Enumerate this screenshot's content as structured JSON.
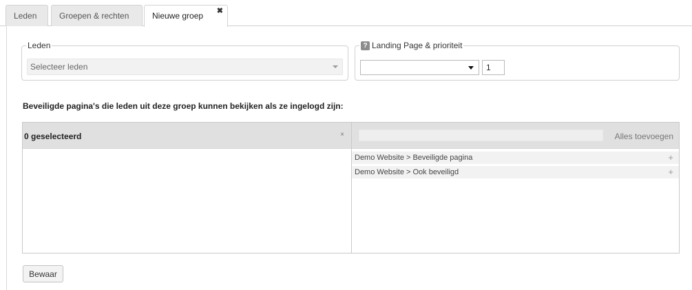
{
  "tabs": [
    {
      "label": "Leden"
    },
    {
      "label": "Groepen & rechten"
    },
    {
      "label": "Nieuwe groep",
      "close": "✖"
    }
  ],
  "leden": {
    "legend": "Leden",
    "placeholder": "Selecteer leden"
  },
  "landing": {
    "help": "?",
    "legend": "Landing Page & prioriteit",
    "page_value": "",
    "priority": "1"
  },
  "secure": {
    "title": "Beveiligde pagina's die leden uit deze groep kunnen bekijken als ze ingelogd zijn:",
    "selected_count": "0 geselecteerd",
    "clear": "×",
    "search_value": "",
    "add_all": "Alles toevoegen",
    "available": [
      {
        "label": "Demo Website > Beveiligde pagina",
        "add": "+"
      },
      {
        "label": "Demo Website > Ook beveiligd",
        "add": "+"
      }
    ]
  },
  "save_label": "Bewaar"
}
